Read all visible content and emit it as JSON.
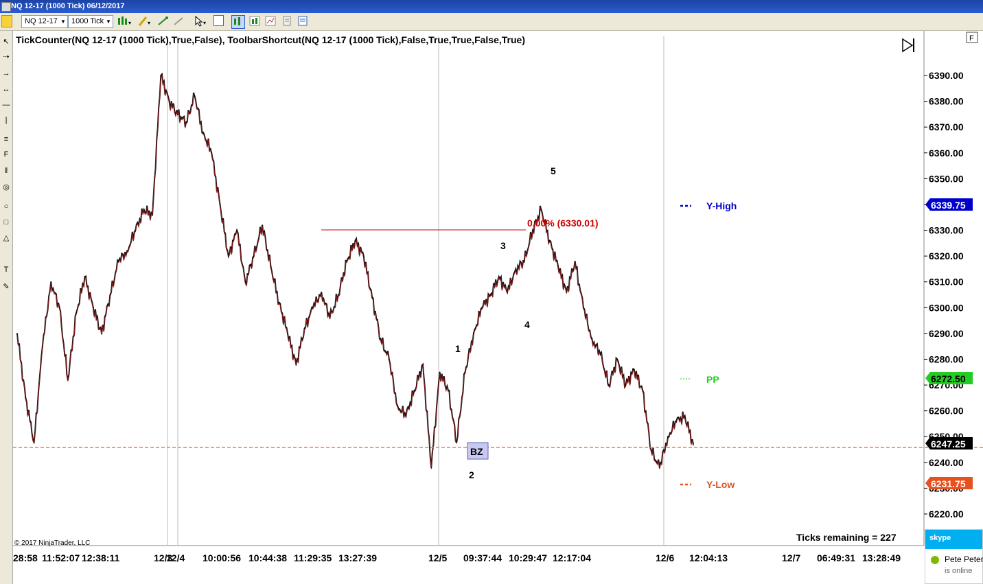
{
  "window": {
    "title": "NQ 12-17 (1000 Tick)  06/12/2017"
  },
  "toolbar": {
    "instrument": "NQ 12-17",
    "interval": "1000 Tick",
    "icons": [
      "candlestick-icon",
      "pencil-icon",
      "crosshair-icon",
      "magnet-icon",
      "pointer-icon",
      "zoom-icon",
      "chart-style-icon",
      "indicator-icon",
      "strategy-icon",
      "properties-icon",
      "data-box-icon"
    ]
  },
  "chart": {
    "indicator_label": "TickCounter(NQ 12-17 (1000 Tick),True,False), ToolbarShortcut(NQ 12-17 (1000 Tick),False,True,True,False,True)",
    "copyright": "© 2017 NinjaTrader, LLC",
    "ticks_remaining": "Ticks remaining = 227",
    "panel_button": "F",
    "price_ticks": [
      "6390.00",
      "6380.00",
      "6370.00",
      "6360.00",
      "6350.00",
      "6340.00",
      "6330.00",
      "6320.00",
      "6310.00",
      "6300.00",
      "6290.00",
      "6280.00",
      "6270.00",
      "6260.00",
      "6250.00",
      "6240.00",
      "6230.00",
      "6220.00"
    ],
    "time_ticks": [
      "28:58",
      "11:52:07",
      "12:38:11",
      "12/3",
      "12/4",
      "10:00:56",
      "10:44:38",
      "11:29:35",
      "13:27:39",
      "12/5",
      "09:37:44",
      "10:29:47",
      "12:17:04",
      "12/6",
      "12:04:13",
      "12/7",
      "06:49:31",
      "13:28:49"
    ],
    "level_labels": {
      "y_high": "Y-High",
      "pp": "PP",
      "y_low": "Y-Low",
      "fib": "0.00% (6330.01)"
    },
    "price_markers": {
      "y_high": "6339.75",
      "pp": "6272.50",
      "last": "6247.25",
      "y_low": "6231.75"
    },
    "wave_labels": [
      "1",
      "2",
      "3",
      "4",
      "5"
    ],
    "bz_label": "BZ",
    "colors": {
      "y_high": "#0000cc",
      "pp": "#22cc22",
      "last": "#000000",
      "y_low": "#e8501e",
      "fib": "#cc0000",
      "last_line": "#f08030"
    }
  },
  "chart_data": {
    "type": "line",
    "title": "",
    "ylim": [
      6215,
      6398
    ],
    "x": [
      0,
      1,
      2,
      3,
      4,
      5,
      6,
      7,
      8,
      9,
      10,
      11,
      12,
      13,
      14,
      15,
      16,
      17,
      18,
      19,
      20,
      21,
      22,
      23,
      24,
      25,
      26,
      27,
      28,
      29,
      30,
      31,
      32,
      33,
      34,
      35,
      36,
      37,
      38,
      39,
      40,
      41,
      42,
      43,
      44,
      45,
      46,
      47,
      48,
      49,
      50,
      51,
      52,
      53,
      54,
      55,
      56,
      57,
      58,
      59,
      60,
      61,
      62,
      63,
      64,
      65,
      66,
      67,
      68,
      69,
      70,
      71,
      72,
      73,
      74,
      75,
      76,
      77,
      78,
      79,
      80
    ],
    "series": [
      {
        "values": [
          6290,
          6265,
          6248,
          6285,
          6310,
          6300,
          6272,
          6298,
          6312,
          6300,
          6290,
          6305,
          6318,
          6322,
          6330,
          6338,
          6336,
          6390,
          6380,
          6375,
          6372,
          6382,
          6368,
          6360,
          6340,
          6320,
          6330,
          6310,
          6320,
          6332,
          6316,
          6302,
          6290,
          6278,
          6292,
          6300,
          6306,
          6296,
          6305,
          6318,
          6326,
          6320,
          6304,
          6288,
          6280,
          6262,
          6258,
          6268,
          6278,
          6238,
          6275,
          6268,
          6248,
          6275,
          6290,
          6300,
          6305,
          6312,
          6306,
          6315,
          6318,
          6330,
          6338,
          6326,
          6316,
          6306,
          6318,
          6300,
          6288,
          6282,
          6270,
          6280,
          6270,
          6276,
          6268,
          6245,
          6238,
          6250,
          6256,
          6258,
          6247
        ]
      }
    ]
  }
}
